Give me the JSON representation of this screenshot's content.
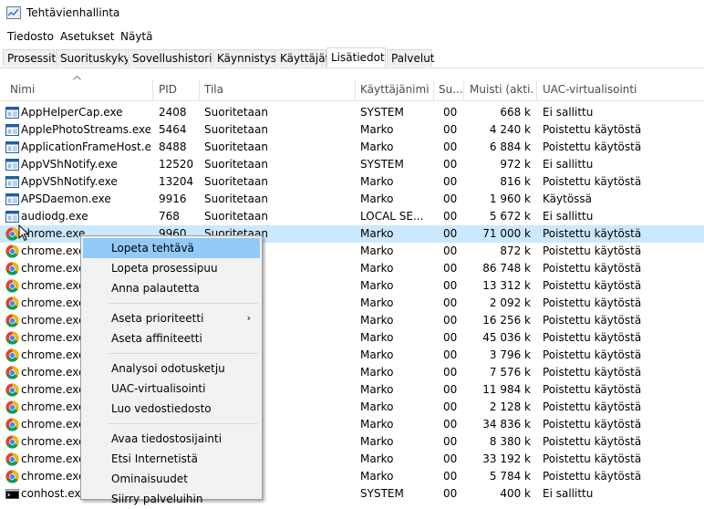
{
  "window": {
    "title": "Tehtävienhallinta",
    "icon": "task-manager-icon"
  },
  "menubar": {
    "items": [
      "Tiedosto",
      "Asetukset",
      "Näytä"
    ]
  },
  "tabs": [
    "Prosessit",
    "Suorituskyky",
    "Sovellushistoria",
    "Käynnistys",
    "Käyttäjät",
    "Lisätiedot",
    "Palvelut"
  ],
  "active_tab": "Lisätiedot",
  "columns": [
    "Nimi",
    "PID",
    "Tila",
    "Käyttäjänimi",
    "Su...",
    "Muisti (akti...",
    "UAC-virtualisointi"
  ],
  "rows": [
    {
      "name": "AppHelperCap.exe",
      "pid": "2408",
      "status": "Suoritetaan",
      "user": "SYSTEM",
      "cpu": "00",
      "mem": "668 k",
      "uac": "Ei sallittu",
      "icon": "app-window-icon"
    },
    {
      "name": "ApplePhotoStreams.exe",
      "pid": "5464",
      "status": "Suoritetaan",
      "user": "Marko",
      "cpu": "00",
      "mem": "4 240 k",
      "uac": "Poistettu käytöstä",
      "icon": "app-window-icon"
    },
    {
      "name": "ApplicationFrameHost.exe",
      "pid": "8488",
      "status": "Suoritetaan",
      "user": "Marko",
      "cpu": "00",
      "mem": "6 884 k",
      "uac": "Poistettu käytöstä",
      "icon": "app-window-icon"
    },
    {
      "name": "AppVShNotify.exe",
      "pid": "12520",
      "status": "Suoritetaan",
      "user": "SYSTEM",
      "cpu": "00",
      "mem": "972 k",
      "uac": "Ei sallittu",
      "icon": "app-window-icon"
    },
    {
      "name": "AppVShNotify.exe",
      "pid": "13204",
      "status": "Suoritetaan",
      "user": "Marko",
      "cpu": "00",
      "mem": "816 k",
      "uac": "Poistettu käytöstä",
      "icon": "app-window-icon"
    },
    {
      "name": "APSDaemon.exe",
      "pid": "9916",
      "status": "Suoritetaan",
      "user": "Marko",
      "cpu": "00",
      "mem": "1 960 k",
      "uac": "Käytössä",
      "icon": "app-window-icon"
    },
    {
      "name": "audiodg.exe",
      "pid": "768",
      "status": "Suoritetaan",
      "user": "LOCAL SE...",
      "cpu": "00",
      "mem": "5 672 k",
      "uac": "Ei sallittu",
      "icon": "app-window-icon"
    },
    {
      "name": "chrome.exe",
      "pid": "9960",
      "status": "Suoritetaan",
      "user": "Marko",
      "cpu": "00",
      "mem": "71 000 k",
      "uac": "Poistettu käytöstä",
      "icon": "chrome-icon",
      "selected": true
    },
    {
      "name": "chrome.exe",
      "pid": "",
      "status": "",
      "user": "Marko",
      "cpu": "00",
      "mem": "872 k",
      "uac": "Poistettu käytöstä",
      "icon": "chrome-icon"
    },
    {
      "name": "chrome.exe",
      "pid": "",
      "status": "",
      "user": "Marko",
      "cpu": "00",
      "mem": "86 748 k",
      "uac": "Poistettu käytöstä",
      "icon": "chrome-icon"
    },
    {
      "name": "chrome.exe",
      "pid": "",
      "status": "",
      "user": "Marko",
      "cpu": "00",
      "mem": "13 312 k",
      "uac": "Poistettu käytöstä",
      "icon": "chrome-icon"
    },
    {
      "name": "chrome.exe",
      "pid": "",
      "status": "",
      "user": "Marko",
      "cpu": "00",
      "mem": "2 092 k",
      "uac": "Poistettu käytöstä",
      "icon": "chrome-icon"
    },
    {
      "name": "chrome.exe",
      "pid": "",
      "status": "",
      "user": "Marko",
      "cpu": "00",
      "mem": "16 256 k",
      "uac": "Poistettu käytöstä",
      "icon": "chrome-icon"
    },
    {
      "name": "chrome.exe",
      "pid": "",
      "status": "",
      "user": "Marko",
      "cpu": "00",
      "mem": "45 036 k",
      "uac": "Poistettu käytöstä",
      "icon": "chrome-icon"
    },
    {
      "name": "chrome.exe",
      "pid": "",
      "status": "",
      "user": "Marko",
      "cpu": "00",
      "mem": "3 796 k",
      "uac": "Poistettu käytöstä",
      "icon": "chrome-icon"
    },
    {
      "name": "chrome.exe",
      "pid": "",
      "status": "",
      "user": "Marko",
      "cpu": "00",
      "mem": "7 576 k",
      "uac": "Poistettu käytöstä",
      "icon": "chrome-icon"
    },
    {
      "name": "chrome.exe",
      "pid": "",
      "status": "",
      "user": "Marko",
      "cpu": "00",
      "mem": "11 984 k",
      "uac": "Poistettu käytöstä",
      "icon": "chrome-icon"
    },
    {
      "name": "chrome.exe",
      "pid": "",
      "status": "",
      "user": "Marko",
      "cpu": "00",
      "mem": "2 128 k",
      "uac": "Poistettu käytöstä",
      "icon": "chrome-icon"
    },
    {
      "name": "chrome.exe",
      "pid": "",
      "status": "",
      "user": "Marko",
      "cpu": "00",
      "mem": "34 836 k",
      "uac": "Poistettu käytöstä",
      "icon": "chrome-icon"
    },
    {
      "name": "chrome.exe",
      "pid": "",
      "status": "",
      "user": "Marko",
      "cpu": "00",
      "mem": "8 380 k",
      "uac": "Poistettu käytöstä",
      "icon": "chrome-icon"
    },
    {
      "name": "chrome.exe",
      "pid": "",
      "status": "",
      "user": "Marko",
      "cpu": "00",
      "mem": "33 192 k",
      "uac": "Poistettu käytöstä",
      "icon": "chrome-icon"
    },
    {
      "name": "chrome.exe",
      "pid": "",
      "status": "",
      "user": "Marko",
      "cpu": "00",
      "mem": "5 784 k",
      "uac": "Poistettu käytöstä",
      "icon": "chrome-icon"
    },
    {
      "name": "conhost.exe",
      "pid": "",
      "status": "",
      "user": "SYSTEM",
      "cpu": "00",
      "mem": "400 k",
      "uac": "Ei sallittu",
      "icon": "console-icon"
    }
  ],
  "context_menu": {
    "items": [
      {
        "label": "Lopeta tehtävä",
        "highlighted": true
      },
      {
        "label": "Lopeta prosessipuu"
      },
      {
        "label": "Anna palautetta"
      },
      {
        "separator": true
      },
      {
        "label": "Aseta prioriteetti",
        "submenu": true
      },
      {
        "label": "Aseta affiniteetti"
      },
      {
        "separator": true
      },
      {
        "label": "Analysoi odotusketju"
      },
      {
        "label": "UAC-virtualisointi"
      },
      {
        "label": "Luo vedostiedosto"
      },
      {
        "separator": true
      },
      {
        "label": "Avaa tiedostosijainti"
      },
      {
        "label": "Etsi Internetistä"
      },
      {
        "label": "Ominaisuudet"
      },
      {
        "label": "Siirry palveluihin"
      }
    ]
  },
  "colors": {
    "selected_row": "#cce8ff",
    "menu_highlight": "#91c9f7",
    "menu_bg": "#f2f2f2"
  }
}
